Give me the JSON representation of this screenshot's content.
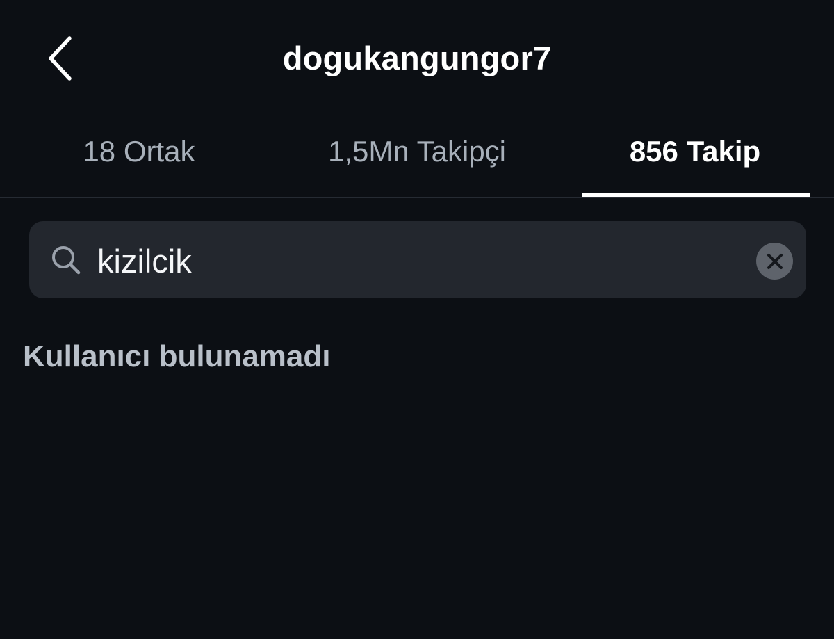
{
  "header": {
    "back_icon": "chevron-left-icon",
    "title": "dogukangungor7"
  },
  "tabs": [
    {
      "label": "18 Ortak",
      "active": false
    },
    {
      "label": "1,5Mn Takipçi",
      "active": false
    },
    {
      "label": "856 Takip",
      "active": true
    }
  ],
  "search": {
    "icon": "search-icon",
    "value": "kizilcik",
    "clear_icon": "close-icon"
  },
  "results": {
    "empty_message": "Kullanıcı bulunamadı"
  },
  "colors": {
    "background": "#0c0f14",
    "search_bg": "#23272e",
    "active_tab": "#ffffff",
    "inactive_tab": "#a8b0ba",
    "muted_text": "#b9c0c9"
  }
}
